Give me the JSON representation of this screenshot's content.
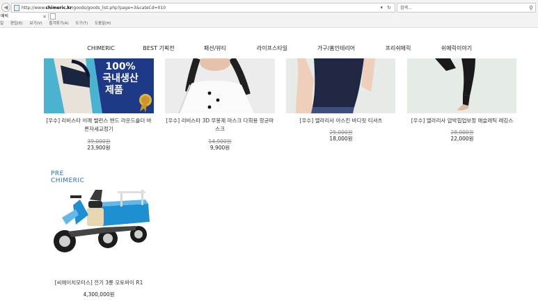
{
  "browser": {
    "url_prefix": "http://www.",
    "url_domain": "chimeric.kr",
    "url_path": "/goods/goods_list.php?page=3&cateCd=010",
    "search_placeholder": "검색...",
    "tab_title": "메릭",
    "menu": [
      "일",
      "편집(E)",
      "보기(V)",
      "즐겨찾기(A)",
      "도구(T)",
      "도움말(H)"
    ]
  },
  "site_nav": [
    "CHIMERIC",
    "BEST 기획전",
    "패션/뷰티",
    "라이프스타일",
    "가구/홈인테리어",
    "프리쉬메릭",
    "쉬메릭이야기"
  ],
  "products": [
    {
      "title_lines": [
        "[우수] 리비스타 어깨 밸런스 밴드 라운드숄더 바",
        "른자세교정기"
      ],
      "original_price": "39,000원",
      "price": "23,900원",
      "badge_lines": [
        "100%",
        "국내생산",
        "제품"
      ]
    },
    {
      "title_lines": [
        "[우수] 리비스타 3D 무봉제 마스크 다회용 항균마",
        "스크"
      ],
      "original_price": "14,900원",
      "price": "9,900원"
    },
    {
      "title_lines": [
        "[우수] 엘라리사 아스킨 바디핏 티셔츠"
      ],
      "original_price": "25,000원",
      "price": "18,000원"
    },
    {
      "title_lines": [
        "[우수] 엘라리사 압박힙업보정 애슬레틱 레깅스"
      ],
      "original_price": "28,000원",
      "price": "22,000원"
    },
    {
      "title_lines": [
        "[씨에이치모터스] 전기 3륜 오토바이 R1"
      ],
      "price": "4,300,000원",
      "logo_lines": [
        "PRE",
        "CHIMERIC"
      ]
    }
  ]
}
